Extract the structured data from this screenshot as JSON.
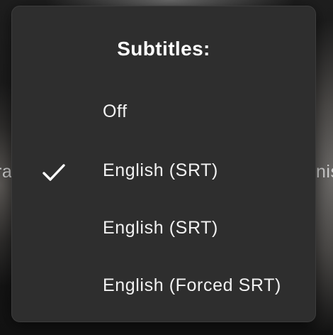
{
  "background": {
    "left_text": "ra",
    "right_text": "nis"
  },
  "subtitles_menu": {
    "title": "Subtitles:",
    "options": [
      {
        "label": "Off",
        "selected": false
      },
      {
        "label": "English (SRT)",
        "selected": true
      },
      {
        "label": "English (SRT)",
        "selected": false
      },
      {
        "label": "English (Forced SRT)",
        "selected": false
      }
    ],
    "selected_icon": "checkmark-icon"
  },
  "colors": {
    "menu_background": "#2e2e2e",
    "text": "#f2f2f2",
    "title": "#ffffff",
    "checkmark": "#ffffff"
  }
}
